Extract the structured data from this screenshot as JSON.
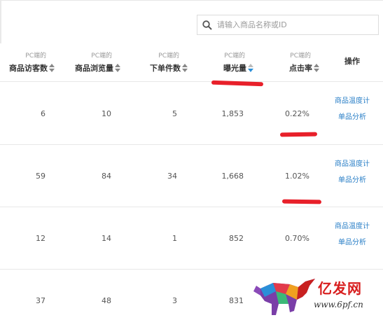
{
  "search": {
    "placeholder": "请输入商品名称或ID",
    "icon": "search-icon"
  },
  "columns": [
    {
      "sub": "PC端的",
      "main": "商品访客数",
      "sort": "none"
    },
    {
      "sub": "PC端的",
      "main": "商品浏览量",
      "sort": "none"
    },
    {
      "sub": "PC端的",
      "main": "下单件数",
      "sort": "none"
    },
    {
      "sub": "PC端的",
      "main": "曝光量",
      "sort": "desc"
    },
    {
      "sub": "PC端的",
      "main": "点击率",
      "sort": "none"
    }
  ],
  "operation_header": "操作",
  "rows": [
    {
      "visitors": "6",
      "views": "10",
      "orders": "5",
      "exposure": "1,853",
      "ctr": "0.22%",
      "op1": "商品温度计",
      "op2": "单品分析"
    },
    {
      "visitors": "59",
      "views": "84",
      "orders": "34",
      "exposure": "1,668",
      "ctr": "1.02%",
      "op1": "商品温度计",
      "op2": "单品分析"
    },
    {
      "visitors": "12",
      "views": "14",
      "orders": "1",
      "exposure": "852",
      "ctr": "0.70%",
      "op1": "商品温度计",
      "op2": "单品分析"
    },
    {
      "visitors": "37",
      "views": "48",
      "orders": "3",
      "exposure": "831",
      "ctr": "",
      "op1": "",
      "op2": ""
    }
  ],
  "watermark": {
    "title": "亿发网",
    "url": "www.6pf.cn"
  },
  "colors": {
    "link": "#2a7fc7",
    "annotation": "#e8202a",
    "sort_active": "#2a8fd8"
  }
}
